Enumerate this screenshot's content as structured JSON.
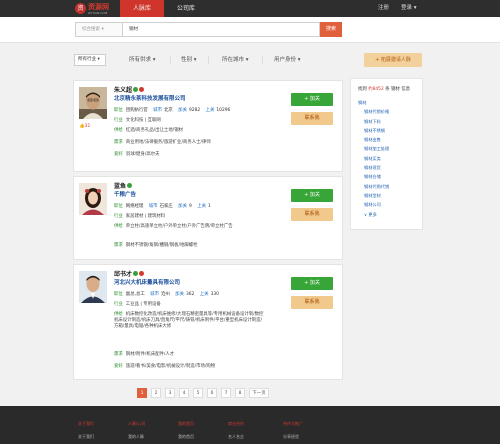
{
  "nav": {
    "logo_main": "资源网",
    "logo_sub": "ZIYUAN.COM",
    "tabs": [
      "人脉库",
      "公司库"
    ],
    "register": "注册",
    "login": "登录"
  },
  "search": {
    "scope": "综合搜索",
    "value": "钢材",
    "button": "搜索"
  },
  "filters": {
    "industry": "所有行业",
    "items": [
      "所有供求",
      "性别",
      "所在城市",
      "用户身份"
    ],
    "expand": "拓展邀请人脉"
  },
  "cards": [
    {
      "name": "朱义超",
      "company": "北京精永茶科技发展有限公司",
      "job_key": "职位",
      "job": "团购执行官",
      "city_key": "城市",
      "city": "北京",
      "add_key": "加关",
      "add": "9282",
      "up_key": "上关",
      "up": "10296",
      "industry_key": "行业",
      "industry": "文化科技 | 互联网",
      "supply_key": "供给",
      "supply": "红酒/商务礼品/出让土地/钢材",
      "demand_key": "需求",
      "demand": "商业用地/法律服务/旅游扩业/商务人士/律师",
      "hobby_key": "爱好",
      "hobby": "羽球/健身/高尔夫",
      "likes": "31",
      "add_btn": "+ 加关",
      "contact_btn": "联系我"
    },
    {
      "name": "蓝鱼",
      "company": "千粮广告",
      "job_key": "职位",
      "job": "网络经理",
      "city_key": "城市",
      "city": "石家庄",
      "add_key": "加关",
      "add": "9",
      "up_key": "上关",
      "up": "1",
      "industry_key": "行业",
      "industry": "家居建材 | 建筑材料",
      "supply_key": "供给",
      "supply": "单立柱/高速单立柱/户外单立柱/户外广告牌/单立柱广告",
      "demand_key": "需求",
      "demand": "钢材不锈钢/角钢/槽钢/钢板/地脚螺栓",
      "likes": "",
      "add_btn": "+ 加关",
      "contact_btn": "联系我"
    },
    {
      "name": "邱书才",
      "company": "河北兴大机床量具有限公司",
      "job_key": "职位",
      "job": "副总,总工",
      "city_key": "城市",
      "city": "沧州",
      "add_key": "加关",
      "add": "362",
      "up_key": "上关",
      "up": "330",
      "industry_key": "行业",
      "industry": "工业品 | 专用设备",
      "supply_key": "供给",
      "supply": "机床数控化改造/机床维修/大理石精密量具等/专用机械设备设计制/数控机床设计制造/机床刀具/直角尺/平尺/铸铁/机床附件/平台/重型机床设计制造/方箱/量具/电锯/各种机床大修",
      "demand_key": "需求",
      "demand": "钢材/附件/机床配件/人才",
      "hobby_key": "爱好",
      "hobby": "旅游/看书/美食/电影/机械设计/制造/市场/购物",
      "likes": "",
      "add_btn": "+ 加关",
      "contact_btn": "联系我"
    }
  ],
  "sidebar": {
    "head_a": "找到",
    "head_count": "约8452",
    "head_b": "条",
    "head_c": "钢材",
    "head_d": "信息",
    "items": [
      {
        "label": "钢材",
        "child": false
      },
      {
        "label": "钢材代销价格",
        "child": true
      },
      {
        "label": "钢材下料",
        "child": true
      },
      {
        "label": "钢材不锈钢",
        "child": true
      },
      {
        "label": "钢材出售",
        "child": true
      },
      {
        "label": "钢材加工处理",
        "child": true
      },
      {
        "label": "钢材买卖",
        "child": true
      },
      {
        "label": "钢材现货",
        "child": true
      },
      {
        "label": "钢材仓储",
        "child": true
      },
      {
        "label": "钢材代购代销",
        "child": true
      },
      {
        "label": "钢材型材",
        "child": true
      },
      {
        "label": "钢材公司",
        "child": true
      },
      {
        "label": "∨ 更多",
        "child": true
      }
    ]
  },
  "pagination": {
    "pages": [
      "1",
      "2",
      "3",
      "4",
      "5",
      "6",
      "7",
      "8"
    ],
    "current": "1",
    "next": "下一页"
  },
  "footer": {
    "cols": [
      {
        "head": "关于我们",
        "item": "关于我们"
      },
      {
        "head": "人脉/公司",
        "item": "我的人脉"
      },
      {
        "head": "我的首页",
        "item": "我的首页"
      },
      {
        "head": "商业合作",
        "item": "名人名企"
      },
      {
        "head": "合作与推广",
        "item": "分享经验"
      }
    ]
  }
}
